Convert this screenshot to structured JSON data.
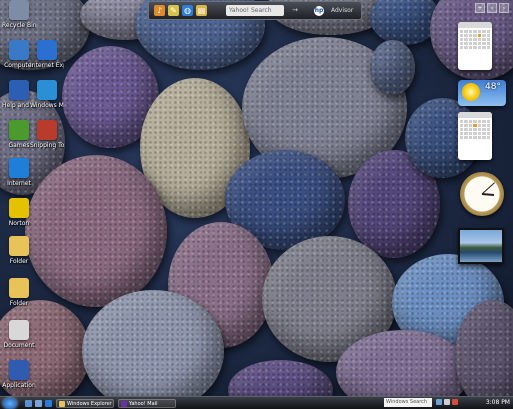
{
  "toolbar": {
    "search_placeholder": "Yahoo! Search",
    "go_label": "→",
    "hp_label": "hp",
    "advisor_label": "Advisor"
  },
  "desktop_icons": [
    {
      "name": "recycle-bin-icon",
      "label": "Recycle Bin",
      "color": "#7d8da6"
    },
    {
      "name": "computer-icon",
      "label": "Computer",
      "color": "#3a78c8"
    },
    {
      "name": "network-icon",
      "label": "Internet Explorer",
      "color": "#2b6fd0"
    },
    {
      "name": "help-icon",
      "label": "Help and Support",
      "color": "#2c5fb3"
    },
    {
      "name": "media-icon",
      "label": "Windows Media Player",
      "color": "#2b8fd6"
    },
    {
      "name": "games-icon",
      "label": "Games",
      "color": "#4a9a2e"
    },
    {
      "name": "snipping-icon",
      "label": "Snipping Tool",
      "color": "#b83b2b"
    },
    {
      "name": "ie-icon",
      "label": "Internet",
      "color": "#1f7fd8"
    },
    {
      "name": "norton-icon",
      "label": "Norton",
      "color": "#e4c200"
    },
    {
      "name": "folder-icon",
      "label": "Folder",
      "color": "#e8c35a"
    },
    {
      "name": "folder-icon",
      "label": "Folder",
      "color": "#e8c35a"
    },
    {
      "name": "document-icon",
      "label": "Document",
      "color": "#d8d8d8"
    },
    {
      "name": "app-icon",
      "label": "Application",
      "color": "#2f5bb0"
    }
  ],
  "weather": {
    "temperature": "48°"
  },
  "taskbar": {
    "tasks": [
      {
        "label": "Windows Explorer",
        "color": "#e8c35a"
      },
      {
        "label": "Yahoo! Mail",
        "color": "#6b2fa8"
      }
    ],
    "search_placeholder": "Windows Search",
    "clock": "3:08 PM"
  },
  "colors": {
    "accent": "#1b4f9c",
    "calendar_highlight": "#f29a2e"
  }
}
